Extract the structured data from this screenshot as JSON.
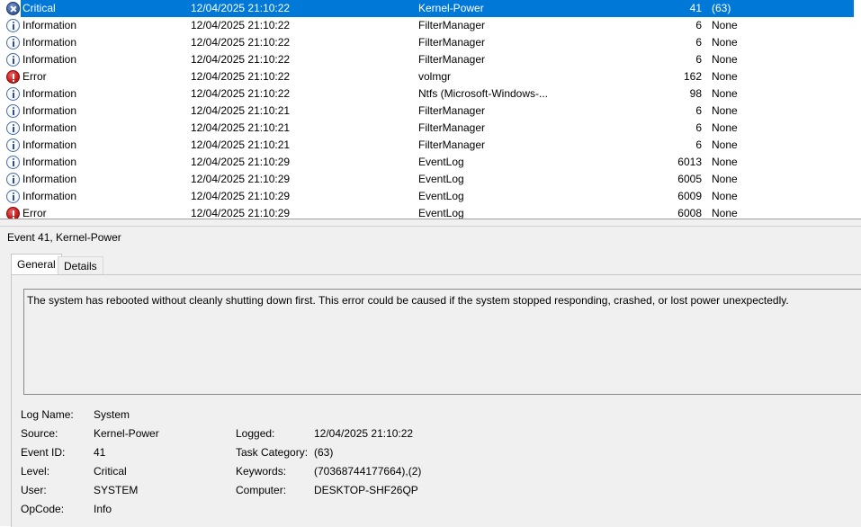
{
  "events": [
    {
      "level": "Critical",
      "icon": "critical-icon",
      "date": "12/04/2025 21:10:22",
      "source": "Kernel-Power",
      "event_id": "41",
      "task": "(63)",
      "selected": true
    },
    {
      "level": "Information",
      "icon": "information-icon",
      "date": "12/04/2025 21:10:22",
      "source": "FilterManager",
      "event_id": "6",
      "task": "None"
    },
    {
      "level": "Information",
      "icon": "information-icon",
      "date": "12/04/2025 21:10:22",
      "source": "FilterManager",
      "event_id": "6",
      "task": "None"
    },
    {
      "level": "Information",
      "icon": "information-icon",
      "date": "12/04/2025 21:10:22",
      "source": "FilterManager",
      "event_id": "6",
      "task": "None"
    },
    {
      "level": "Error",
      "icon": "error-icon",
      "date": "12/04/2025 21:10:22",
      "source": "volmgr",
      "event_id": "162",
      "task": "None"
    },
    {
      "level": "Information",
      "icon": "information-icon",
      "date": "12/04/2025 21:10:22",
      "source": "Ntfs (Microsoft-Windows-...",
      "event_id": "98",
      "task": "None"
    },
    {
      "level": "Information",
      "icon": "information-icon",
      "date": "12/04/2025 21:10:21",
      "source": "FilterManager",
      "event_id": "6",
      "task": "None"
    },
    {
      "level": "Information",
      "icon": "information-icon",
      "date": "12/04/2025 21:10:21",
      "source": "FilterManager",
      "event_id": "6",
      "task": "None"
    },
    {
      "level": "Information",
      "icon": "information-icon",
      "date": "12/04/2025 21:10:21",
      "source": "FilterManager",
      "event_id": "6",
      "task": "None"
    },
    {
      "level": "Information",
      "icon": "information-icon",
      "date": "12/04/2025 21:10:29",
      "source": "EventLog",
      "event_id": "6013",
      "task": "None"
    },
    {
      "level": "Information",
      "icon": "information-icon",
      "date": "12/04/2025 21:10:29",
      "source": "EventLog",
      "event_id": "6005",
      "task": "None"
    },
    {
      "level": "Information",
      "icon": "information-icon",
      "date": "12/04/2025 21:10:29",
      "source": "EventLog",
      "event_id": "6009",
      "task": "None"
    },
    {
      "level": "Error",
      "icon": "error-icon",
      "date": "12/04/2025 21:10:29",
      "source": "EventLog",
      "event_id": "6008",
      "task": "None"
    }
  ],
  "colors": {
    "selection": "#0078d7",
    "panel_bg": "#f0f0f0"
  },
  "detail": {
    "title": "Event 41, Kernel-Power",
    "tabs": [
      "General",
      "Details"
    ],
    "active_tab": "General",
    "message": "The system has rebooted without cleanly shutting down first. This error could be caused if the system stopped responding, crashed, or lost power unexpectedly.",
    "props": {
      "log_name_label": "Log Name:",
      "log_name": "System",
      "source_label": "Source:",
      "source": "Kernel-Power",
      "logged_label": "Logged:",
      "logged": "12/04/2025 21:10:22",
      "event_id_label": "Event ID:",
      "event_id": "41",
      "task_category_label": "Task Category:",
      "task_category": "(63)",
      "level_label": "Level:",
      "level": "Critical",
      "keywords_label": "Keywords:",
      "keywords": "(70368744177664),(2)",
      "user_label": "User:",
      "user": "SYSTEM",
      "computer_label": "Computer:",
      "computer": "DESKTOP-SHF26QP",
      "opcode_label": "OpCode:",
      "opcode": "Info"
    }
  }
}
